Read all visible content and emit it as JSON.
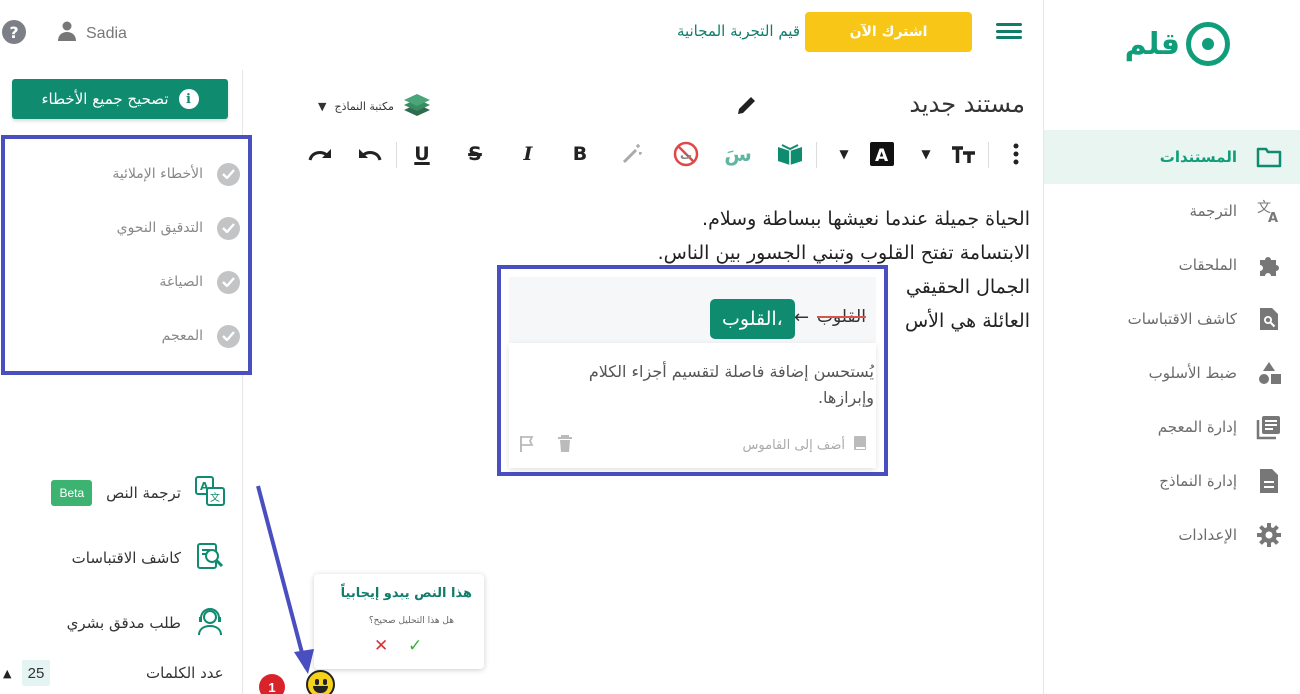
{
  "header": {
    "subscribe_label": "اشترك الآن",
    "trial_label": "قيم التجربة المجانية",
    "user_name": "Sadia",
    "help_label": "?"
  },
  "brand": {
    "logo_text": "قلم"
  },
  "nav": {
    "items": [
      {
        "label": "المستندات",
        "icon": "folder-icon",
        "active": true
      },
      {
        "label": "الترجمة",
        "icon": "translate-icon"
      },
      {
        "label": "الملحقات",
        "icon": "puzzle-icon"
      },
      {
        "label": "كاشف الاقتباسات",
        "icon": "search-doc-icon"
      },
      {
        "label": "ضبط الأسلوب",
        "icon": "shapes-icon"
      },
      {
        "label": "إدارة المعجم",
        "icon": "book-icon"
      },
      {
        "label": "إدارة النماذج",
        "icon": "document-icon"
      },
      {
        "label": "الإعدادات",
        "icon": "gear-icon"
      }
    ]
  },
  "left_panel": {
    "fix_all_label": "تصحيح جميع الأخطاء",
    "checks": [
      {
        "label": "الأخطاء الإملائية"
      },
      {
        "label": "التدقيق النحوي"
      },
      {
        "label": "الصياغة"
      },
      {
        "label": "المعجم"
      }
    ],
    "tools": [
      {
        "label": "ترجمة النص",
        "badge": "Beta"
      },
      {
        "label": "كاشف الاقتباسات"
      },
      {
        "label": "طلب مدقق بشري"
      }
    ],
    "word_count_label": "عدد الكلمات",
    "word_count_value": "25"
  },
  "editor": {
    "title": "مستند جديد",
    "library_label": "مكتبة النماذج",
    "lines": [
      "الحياة جميلة عندما نعيشها ببساطة وسلام.",
      "الابتسامة تفتح القلوب وتبني الجسور بين الناس.",
      "الجمال الحقيقي",
      "العائلة هي الأس"
    ]
  },
  "suggestion": {
    "original": "القلوب",
    "replacement": "القلوب،",
    "description": "يُستحسن إضافة فاصلة لتقسيم أجزاء الكلام وإبرازها.",
    "add_to_dictionary": "أضف إلى القاموس"
  },
  "sentiment": {
    "title": "هذا النص يبدو إيجابياً",
    "question": "هل هذا التحليل صحيح؟",
    "issues_count": "1"
  },
  "colors": {
    "brand": "#0f8c6f",
    "subscribe": "#f7c617",
    "annotation": "#4a4fc0"
  }
}
